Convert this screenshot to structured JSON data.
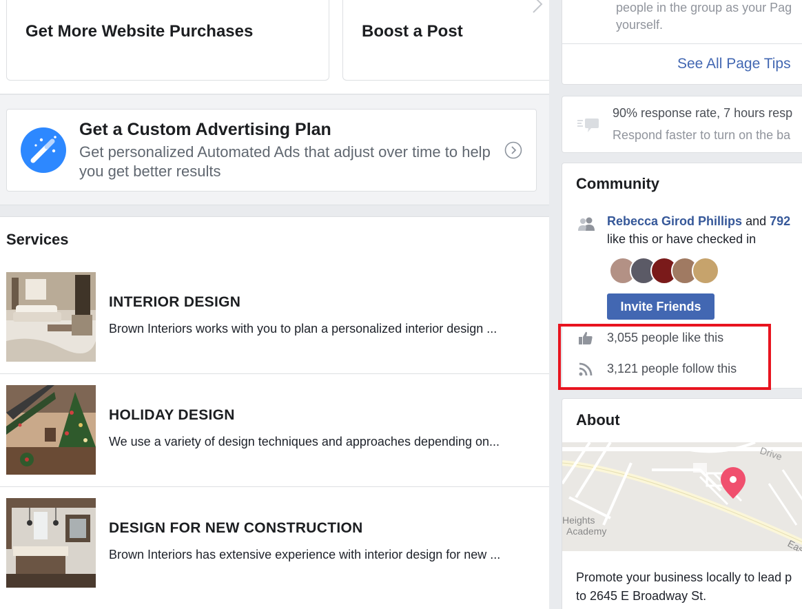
{
  "promos": {
    "card1_title": "Get More Website Purchases",
    "card2_title": "Boost a Post"
  },
  "ad_plan": {
    "title": "Get a Custom Advertising Plan",
    "description": "Get personalized Automated Ads that adjust over time to help you get better results"
  },
  "services": {
    "title": "Services",
    "items": [
      {
        "name": "INTERIOR DESIGN",
        "description": "Brown Interiors works with you to plan a personalized interior design ..."
      },
      {
        "name": "HOLIDAY DESIGN",
        "description": "We use a variety of design techniques and approaches depending on..."
      },
      {
        "name": "DESIGN FOR NEW CONSTRUCTION",
        "description": "Brown Interiors has extensive experience with interior design for new ..."
      }
    ]
  },
  "page_tips": {
    "text_line1": "people in the group as your Pag",
    "text_line2": "yourself.",
    "link": "See All Page Tips"
  },
  "response": {
    "line1": "90% response rate, 7 hours resp",
    "line2": "Respond faster to turn on the ba"
  },
  "community": {
    "title": "Community",
    "friend_name": "Rebecca Girod Phillips",
    "friend_connector": " and ",
    "friend_count_partial": "792",
    "friend_line2": "like this or have checked in",
    "invite_label": "Invite Friends",
    "likes": "3,055 people like this",
    "follows": "3,121 people follow this"
  },
  "about": {
    "title": "About",
    "map_labels": {
      "drive": "Drive",
      "heights": "Heights",
      "academy": "Academy",
      "east": "Eas"
    },
    "desc_line1": "Promote your business locally to lead p",
    "desc_line2": "to 2645 E Broadway St."
  },
  "colors": {
    "link_blue": "#365899",
    "button_blue": "#4267b2",
    "plan_icon_blue": "#2d88ff",
    "highlight_red": "#e8141f",
    "map_pin": "#f0506e"
  }
}
